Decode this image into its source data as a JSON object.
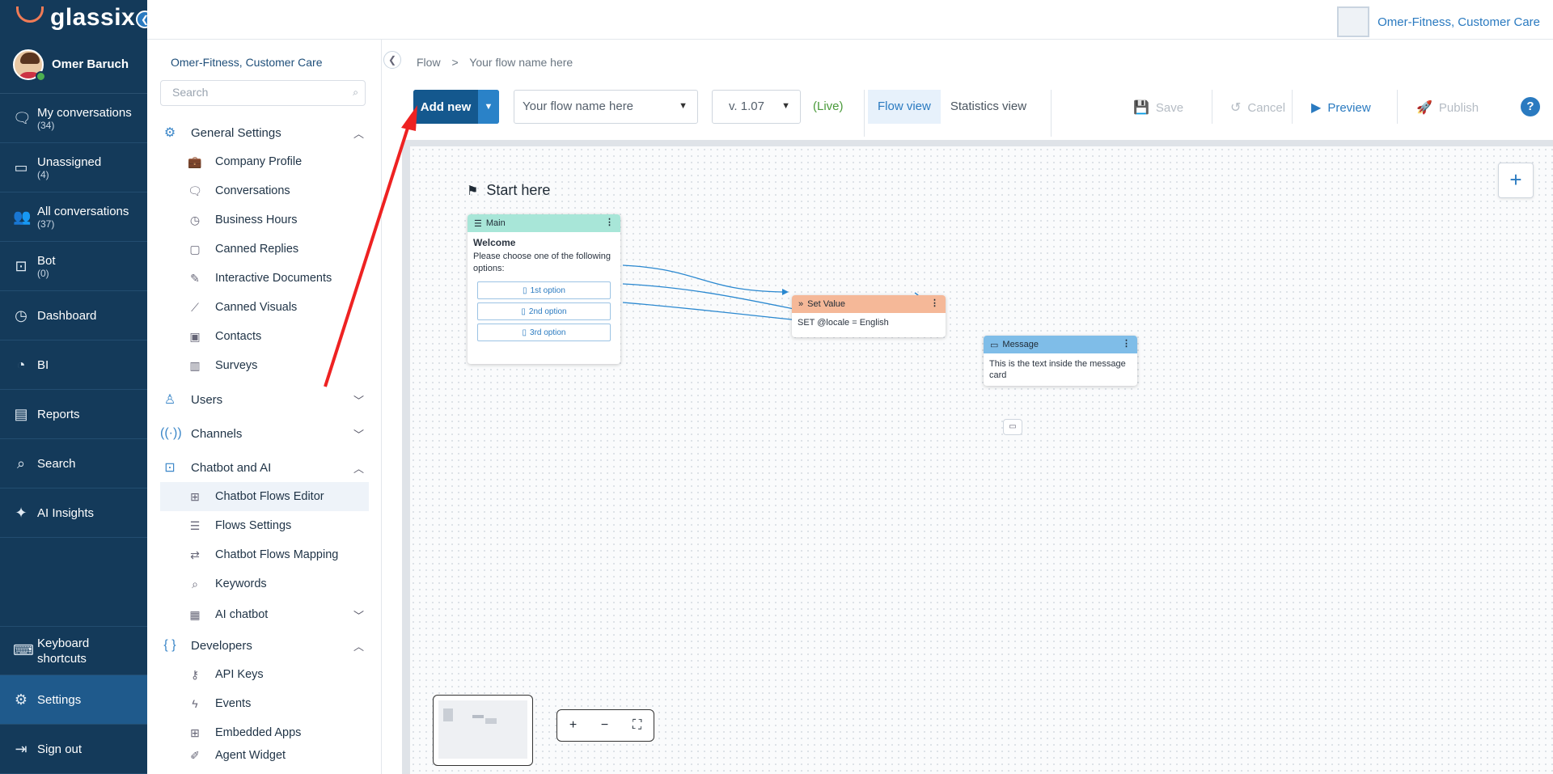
{
  "app": {
    "name": "glassix"
  },
  "user": {
    "name": "Omer Baruch"
  },
  "nav": {
    "items": [
      {
        "label": "My conversations",
        "count": "(34)",
        "icon": "chat-icon"
      },
      {
        "label": "Unassigned",
        "count": "(4)",
        "icon": "inbox-icon"
      },
      {
        "label": "All conversations",
        "count": "(37)",
        "icon": "users-icon"
      },
      {
        "label": "Bot",
        "count": "(0)",
        "icon": "bot-icon"
      },
      {
        "label": "Dashboard",
        "count": "",
        "icon": "dashboard-icon"
      },
      {
        "label": "BI",
        "count": "",
        "icon": "pie-icon"
      },
      {
        "label": "Reports",
        "count": "",
        "icon": "report-icon"
      },
      {
        "label": "Search",
        "count": "",
        "icon": "search-icon"
      },
      {
        "label": "AI Insights",
        "count": "",
        "icon": "sparkle-icon"
      }
    ],
    "bottom": [
      {
        "label": "Keyboard shortcuts",
        "icon": "keyboard-icon"
      },
      {
        "label": "Settings",
        "icon": "gear-icon"
      },
      {
        "label": "Sign out",
        "icon": "signout-icon"
      }
    ]
  },
  "header": {
    "org": "Omer-Fitness, Customer Care"
  },
  "settings": {
    "title": "Omer-Fitness, Customer Care",
    "search_placeholder": "Search",
    "general": {
      "label": "General Settings",
      "items": [
        "Company Profile",
        "Conversations",
        "Business Hours",
        "Canned Replies",
        "Interactive Documents",
        "Canned Visuals",
        "Contacts",
        "Surveys"
      ]
    },
    "users": "Users",
    "channels": "Channels",
    "chatbot": {
      "label": "Chatbot and AI",
      "items": [
        "Chatbot Flows Editor",
        "Flows Settings",
        "Chatbot Flows Mapping",
        "Keywords"
      ],
      "ai": "AI chatbot"
    },
    "developers": {
      "label": "Developers",
      "items": [
        "API Keys",
        "Events",
        "Embedded Apps",
        "Agent Widget"
      ]
    }
  },
  "flow": {
    "breadcrumb": [
      "Flow",
      ">",
      "Your flow name here"
    ],
    "add_new": "Add new",
    "name": "Your flow name here",
    "version": "v. 1.07",
    "status": "(Live)",
    "views": [
      "Flow view",
      "Statistics view"
    ],
    "actions": {
      "save": "Save",
      "cancel": "Cancel",
      "preview": "Preview",
      "publish": "Publish"
    },
    "help": "?",
    "start": "Start here",
    "main_card": {
      "header": "Main",
      "title": "Welcome",
      "text": "Please choose one of the following options:",
      "options": [
        "1st option",
        "2nd option",
        "3rd option"
      ]
    },
    "set_value_card": {
      "header": "Set Value",
      "text": "SET @locale = English"
    },
    "message_card": {
      "header": "Message",
      "text": "This is the text inside the message card"
    }
  },
  "colors": {
    "nav": "#143a5a",
    "accent": "#2a7ac0",
    "main_header": "#a8e6d8",
    "set_header": "#f5b898",
    "msg_header": "#7fbde8"
  }
}
